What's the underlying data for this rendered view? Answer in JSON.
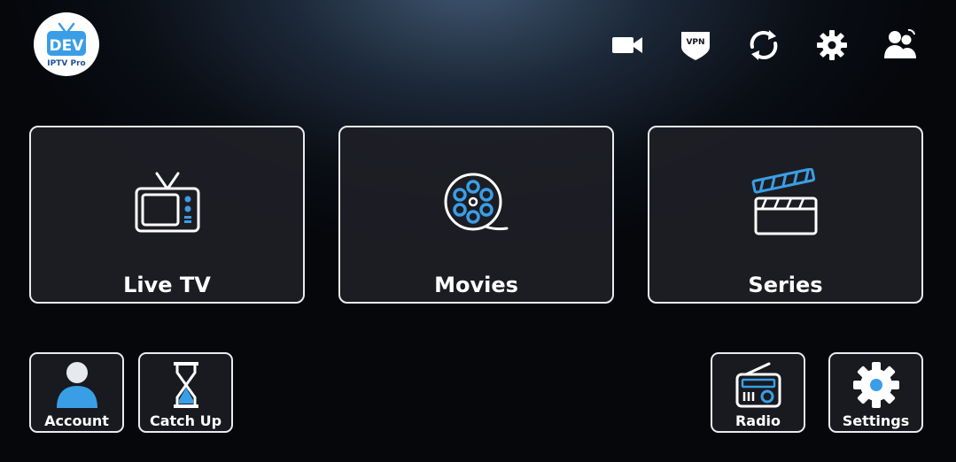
{
  "logo": {
    "main_text": "DEV",
    "sub_text": "IPTV Pro",
    "icon": "tv-logo-icon"
  },
  "toolbar": [
    {
      "id": "record",
      "icon": "video-camera-icon"
    },
    {
      "id": "vpn",
      "icon": "vpn-shield-icon",
      "text": "VPN"
    },
    {
      "id": "refresh",
      "icon": "refresh-icon"
    },
    {
      "id": "settings",
      "icon": "gear-icon"
    },
    {
      "id": "switch-user",
      "icon": "switch-user-icon"
    }
  ],
  "main_tiles": [
    {
      "label": "Live TV",
      "icon": "tv-icon"
    },
    {
      "label": "Movies",
      "icon": "film-reel-icon"
    },
    {
      "label": "Series",
      "icon": "clapperboard-icon"
    }
  ],
  "bottom_tiles": [
    {
      "label": "Account",
      "icon": "user-icon"
    },
    {
      "label": "Catch Up",
      "icon": "hourglass-icon"
    },
    {
      "label": "Radio",
      "icon": "radio-icon"
    },
    {
      "label": "Settings",
      "icon": "gear-icon"
    }
  ],
  "colors": {
    "accent": "#3a9ee6",
    "border": "#e8ebef",
    "tile_bg": "#1e2026",
    "logo_blue": "#1f4f9a"
  }
}
